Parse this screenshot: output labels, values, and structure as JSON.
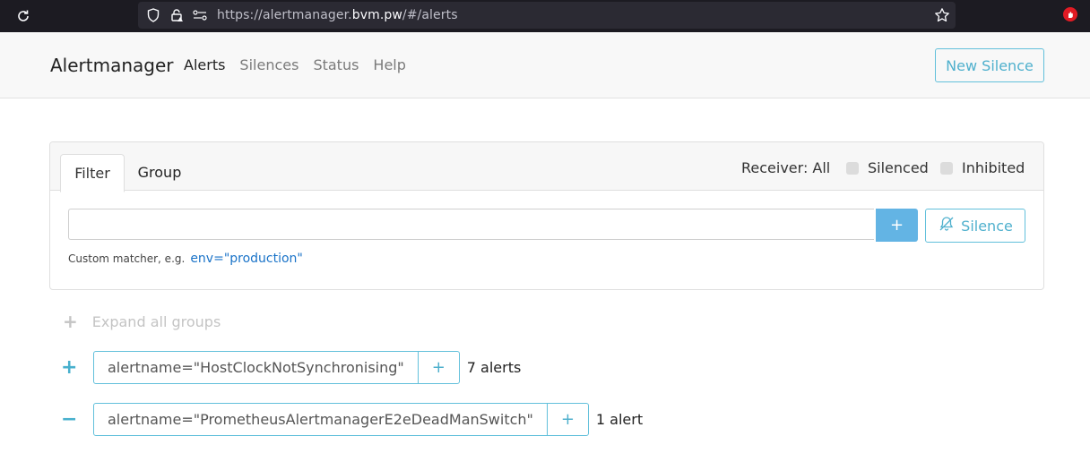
{
  "browser": {
    "url_prefix": "https://alertmanager.",
    "url_host": "bvm.pw",
    "url_suffix": "/#/alerts"
  },
  "navbar": {
    "brand": "Alertmanager",
    "links": [
      {
        "label": "Alerts",
        "active": true
      },
      {
        "label": "Silences",
        "active": false
      },
      {
        "label": "Status",
        "active": false
      },
      {
        "label": "Help",
        "active": false
      }
    ],
    "new_silence_label": "New Silence"
  },
  "filter_card": {
    "tabs": [
      {
        "label": "Filter",
        "active": true
      },
      {
        "label": "Group",
        "active": false
      }
    ],
    "receiver_label": "Receiver: All",
    "silenced_label": "Silenced",
    "inhibited_label": "Inhibited",
    "input_value": "",
    "add_label": "+",
    "silence_label": "Silence",
    "hint_text": "Custom matcher, e.g.",
    "hint_example": "env=\"production\""
  },
  "groups": {
    "expand_all_label": "Expand all groups",
    "items": [
      {
        "toggle": "+",
        "matcher": "alertname=\"HostClockNotSynchronising\"",
        "add": "+",
        "count": "7 alerts"
      },
      {
        "toggle": "−",
        "matcher": "alertname=\"PrometheusAlertmanagerE2eDeadManSwitch\"",
        "add": "+",
        "count": "1 alert"
      }
    ]
  },
  "icons": {
    "reload": "reload-icon",
    "shield": "shield-icon",
    "lock": "insecure-lock-icon",
    "permissions": "permissions-icon",
    "star": "bookmark-star-icon",
    "extension": "extension-icon",
    "bell_off": "bell-slash-icon"
  },
  "colors": {
    "accent": "#4fb0cd",
    "primary_button": "#63b4e4",
    "browser_bg": "#1c1b22"
  }
}
